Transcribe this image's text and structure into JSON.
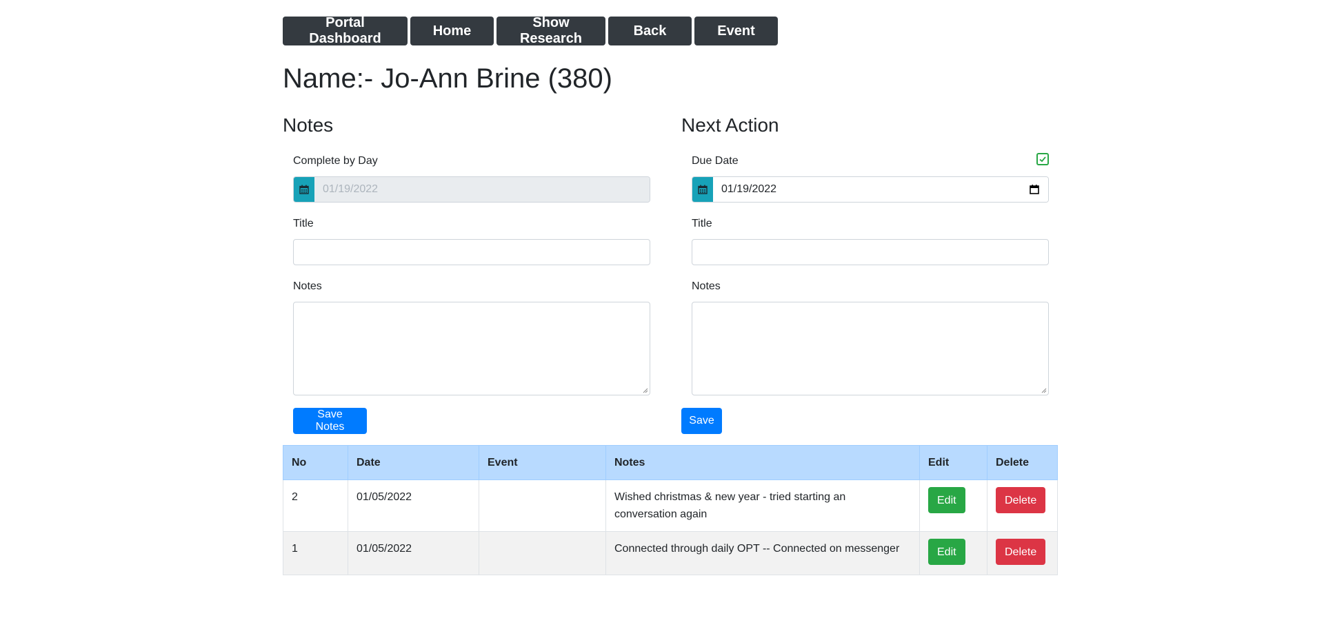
{
  "nav": {
    "items": [
      "Portal Dashboard",
      "Home",
      "Show Research",
      "Back",
      "Event"
    ]
  },
  "page_title": "Name:- Jo-Ann Brine (380)",
  "notes_section": {
    "heading": "Notes",
    "complete_by_label": "Complete by Day",
    "complete_by_value": "01/19/2022",
    "title_label": "Title",
    "title_value": "",
    "notes_label": "Notes",
    "notes_value": "",
    "save_label": "Save Notes"
  },
  "next_action": {
    "heading": "Next Action",
    "due_date_label": "Due Date",
    "due_date_value": "01/19/2022",
    "due_date_checked": true,
    "title_label": "Title",
    "title_value": "",
    "notes_label": "Notes",
    "notes_value": "",
    "save_label": "Save"
  },
  "table": {
    "headers": [
      "No",
      "Date",
      "Event",
      "Notes",
      "Edit",
      "Delete"
    ],
    "rows": [
      {
        "no": "2",
        "date": "01/05/2022",
        "event": "",
        "notes": "Wished christmas & new year - tried starting an conversation again",
        "edit": "Edit",
        "delete": "Delete"
      },
      {
        "no": "1",
        "date": "01/05/2022",
        "event": "",
        "notes": "Connected through daily OPT -- Connected on messenger",
        "edit": "Edit",
        "delete": "Delete"
      }
    ]
  },
  "colors": {
    "nav_bg": "#343a40",
    "primary": "#007bff",
    "success": "#28a745",
    "danger": "#dc3545",
    "info": "#17a2b8",
    "table_header": "#b8daff"
  },
  "icons": {
    "calendar": "calendar-icon",
    "checkbox": "check-icon"
  }
}
